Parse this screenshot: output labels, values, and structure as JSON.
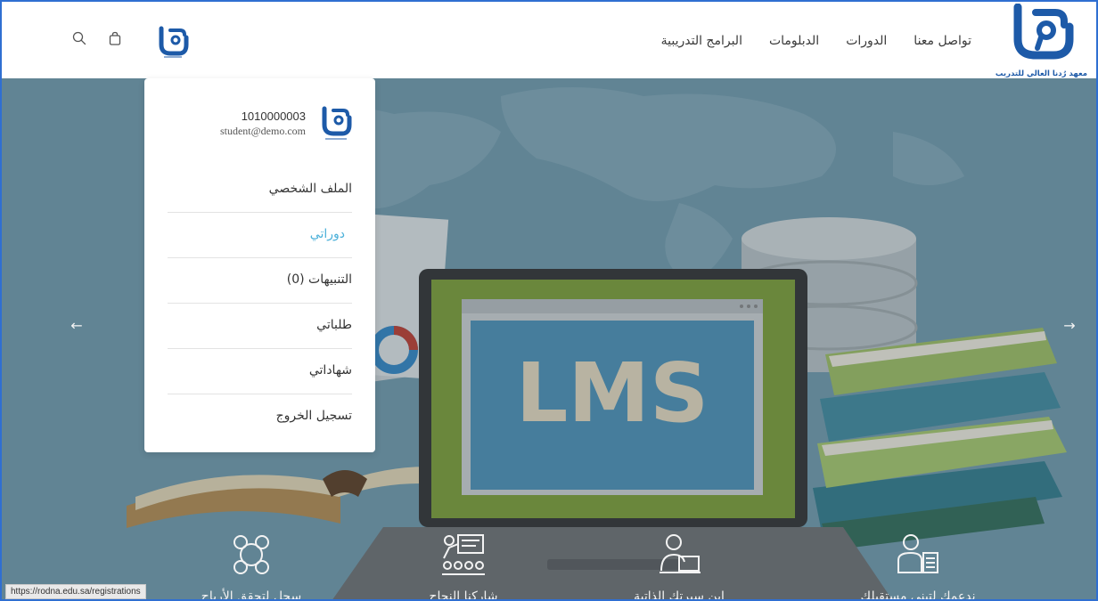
{
  "header": {
    "logo_caption": "معهد رُدنا العالي للتدريب",
    "nav": [
      "البرامج التدريبية",
      "الدبلومات",
      "الدورات",
      "تواصل معنا"
    ]
  },
  "icons": {
    "search": "search-icon",
    "cart": "shopping-bag-icon",
    "prev": "arrow-left-icon",
    "next": "arrow-right-icon"
  },
  "hero": {
    "prev_arrow": "←",
    "next_arrow": "→",
    "screen_text": "LMS",
    "features": [
      "ندعمك لتبني مستقبلك",
      "ابن سيرتك الذاتية",
      "شاركنا النجاح",
      "سجل لتحقق الأرباح"
    ]
  },
  "user_menu": {
    "user_id": "1010000003",
    "email": "student@demo.com",
    "items": [
      {
        "label": "الملف الشخصي",
        "active": false
      },
      {
        "label": "دوراتي",
        "active": true
      },
      {
        "label": "التنبيهات (0)",
        "active": false
      },
      {
        "label": "طلباتي",
        "active": false
      },
      {
        "label": "شهاداتي",
        "active": false
      },
      {
        "label": "تسجيل الخروج",
        "active": false
      }
    ]
  },
  "status_bar": {
    "url": "https://rodna.edu.sa/registrations"
  },
  "colors": {
    "brand_blue": "#1d5aa8",
    "active_item": "#4ab0d9",
    "hero_bg": "#6f9aac"
  }
}
